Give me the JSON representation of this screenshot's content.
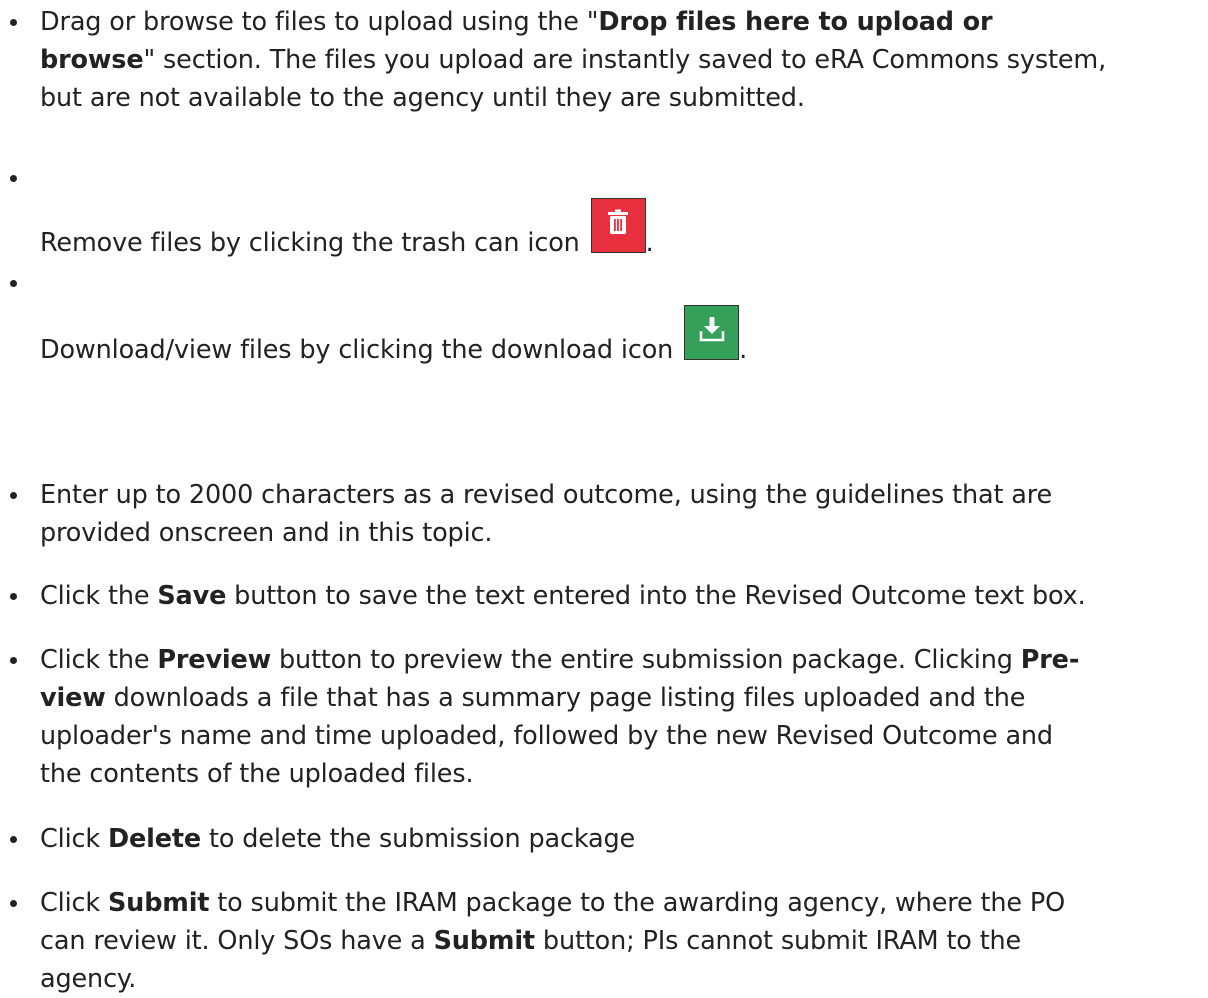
{
  "bullets": {
    "b1": {
      "l1_a": "Drag or browse to files to upload using the \"",
      "l1_b": "Drop files here to upload or",
      "l2_a": "browse",
      "l2_b": "\" section. The files you upload are instantly saved to eRA Commons system,",
      "l3": "but are not available to the agency until they are submitted."
    },
    "b2": {
      "text": "Remove files by clicking the trash can icon ",
      "after": ".",
      "icon": "trash-icon",
      "icon_color": "#e8303f"
    },
    "b3": {
      "text": "Download/view files by clicking the download icon ",
      "after": ".",
      "icon": "download-icon",
      "icon_color": "#34a05a"
    },
    "b4": {
      "l1": "Enter up to 2000 characters as a revised outcome, using the guidelines that are",
      "l2": "provided onscreen and in this topic."
    },
    "b5": {
      "a": "Click the ",
      "bold": "Save",
      "b": " button to save the text entered into the Revised Outcome text box."
    },
    "b6": {
      "l1_a": "Click the ",
      "l1_bold1": "Preview",
      "l1_b": " button to preview the entire submission package. Clicking ",
      "l1_bold2": "Pre-",
      "l2_bold": "view",
      "l2_a": " downloads a file that has a summary page listing files uploaded and the",
      "l3": "uploader's name and time uploaded, followed by the new Revised Outcome and",
      "l4": "the contents of the uploaded files."
    },
    "b7": {
      "a": "Click ",
      "bold": "Delete",
      "b": " to delete the submission package"
    },
    "b8": {
      "l1_a": "Click ",
      "l1_bold": "Submit",
      "l1_b": " to submit the IRAM package to the awarding agency, where the PO",
      "l2_a": "can review it. Only SOs have a ",
      "l2_bold": "Submit",
      "l2_b": " button; PIs cannot submit IRAM to the",
      "l3": "agency."
    }
  }
}
